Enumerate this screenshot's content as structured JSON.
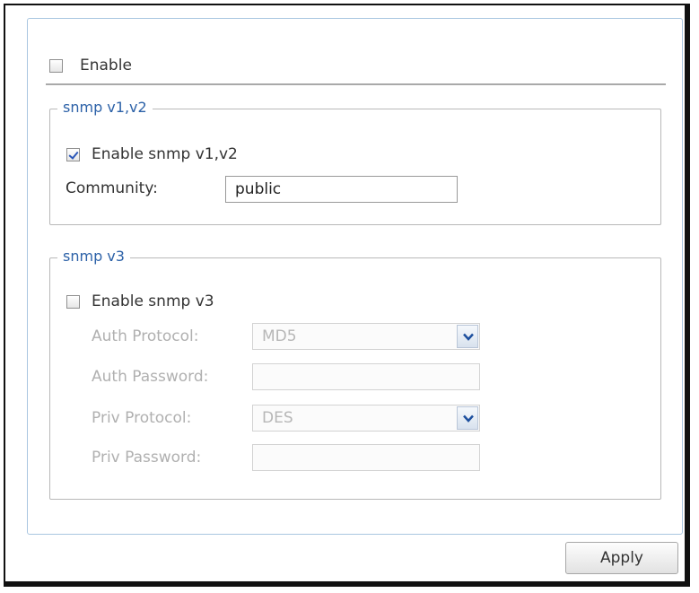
{
  "enable": {
    "label": "Enable",
    "checked": false
  },
  "snmp_v1v2": {
    "legend": "snmp v1,v2",
    "enable_label": "Enable snmp v1,v2",
    "enabled": true,
    "community_label": "Community:",
    "community_value": "public"
  },
  "snmp_v3": {
    "legend": "snmp v3",
    "enable_label": "Enable snmp v3",
    "enabled": false,
    "auth_protocol_label": "Auth Protocol:",
    "auth_protocol_value": "MD5",
    "auth_password_label": "Auth Password:",
    "auth_password_value": "",
    "priv_protocol_label": "Priv Protocol:",
    "priv_protocol_value": "DES",
    "priv_password_label": "Priv Password:",
    "priv_password_value": ""
  },
  "apply_label": "Apply",
  "colors": {
    "legend_text": "#2d62a8",
    "panel_border": "#a9c6e0",
    "disabled_text": "#b0b0b0"
  },
  "icons": {
    "dropdown": "chevron-down-icon",
    "check": "checkmark-icon"
  }
}
